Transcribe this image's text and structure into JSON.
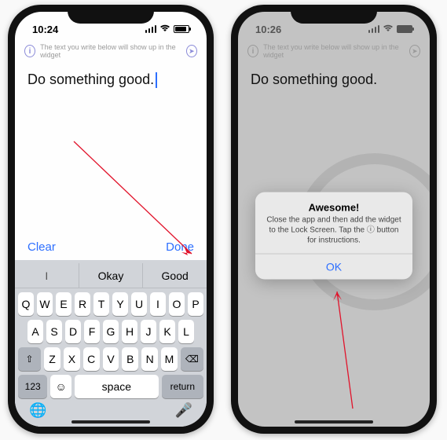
{
  "left": {
    "time": "10:24",
    "hint": "The text you write below will show up in the widget",
    "text": "Do something good.",
    "clear": "Clear",
    "done": "Done",
    "suggestions": [
      "I",
      "Okay",
      "Good"
    ],
    "rows": {
      "r1": [
        "Q",
        "W",
        "E",
        "R",
        "T",
        "Y",
        "U",
        "I",
        "O",
        "P"
      ],
      "r2": [
        "A",
        "S",
        "D",
        "F",
        "G",
        "H",
        "J",
        "K",
        "L"
      ],
      "r3_shift": "⇧",
      "r3": [
        "Z",
        "X",
        "C",
        "V",
        "B",
        "N",
        "M"
      ],
      "r3_del": "⌫",
      "numKey": "123",
      "emoji": "☺",
      "space": "space",
      "ret": "return",
      "globe": "🌐",
      "mic": "🎤"
    }
  },
  "right": {
    "time": "10:26",
    "hint": "The text you write below will show up in the widget",
    "text": "Do something good.",
    "alert": {
      "title": "Awesome!",
      "body": "Close the app and then add the widget to the Lock Screen. Tap the ⓘ button for instructions.",
      "ok": "OK"
    }
  }
}
